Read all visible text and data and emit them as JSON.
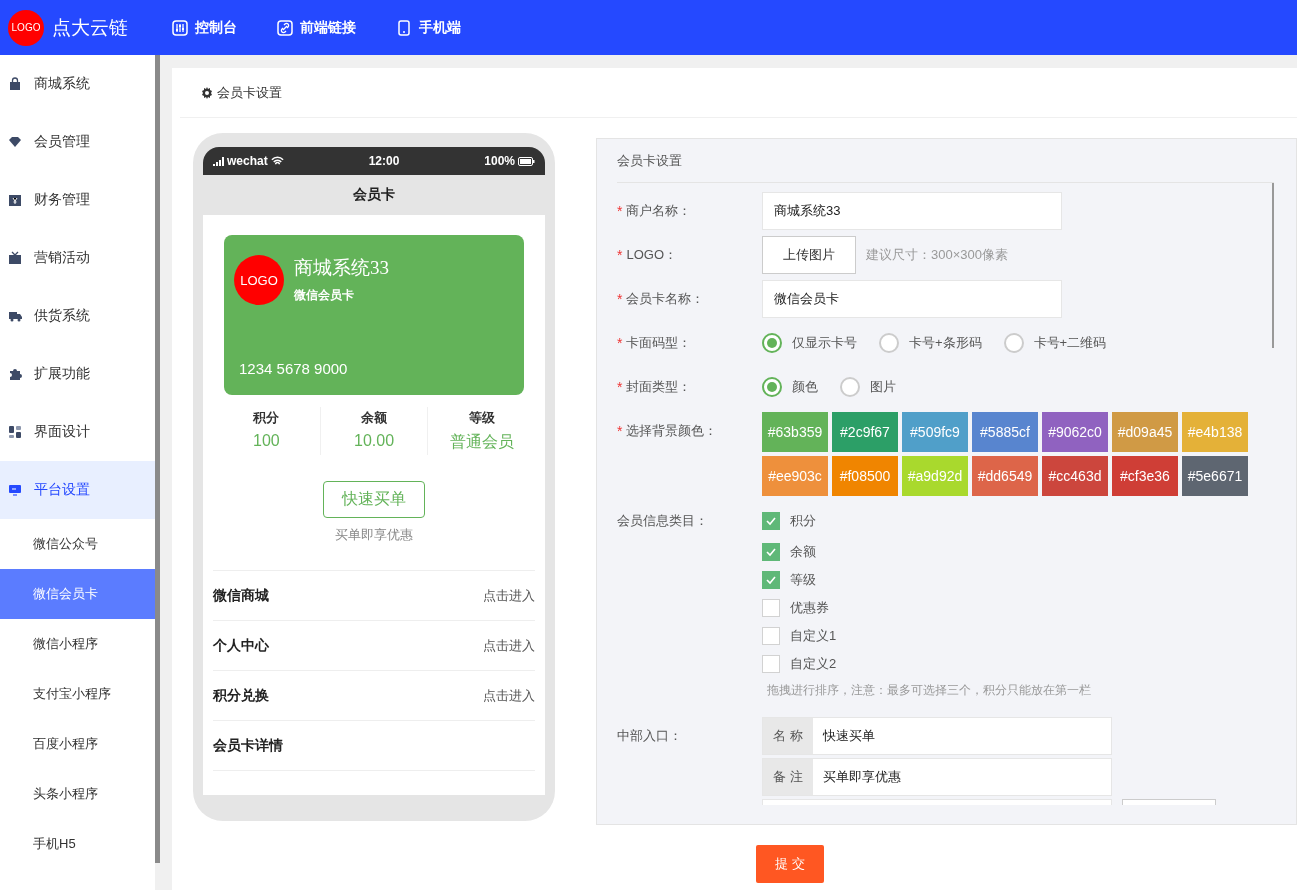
{
  "header": {
    "logo": "LOGO",
    "brand": "点大云链",
    "nav": [
      {
        "label": "控制台"
      },
      {
        "label": "前端链接"
      },
      {
        "label": "手机端"
      }
    ]
  },
  "sidebar": {
    "items": [
      {
        "label": "商城系统",
        "expanded": false
      },
      {
        "label": "会员管理",
        "expanded": false
      },
      {
        "label": "财务管理",
        "expanded": false
      },
      {
        "label": "营销活动",
        "expanded": false
      },
      {
        "label": "供货系统",
        "expanded": false
      },
      {
        "label": "扩展功能",
        "expanded": false
      },
      {
        "label": "界面设计",
        "expanded": false
      },
      {
        "label": "平台设置",
        "expanded": true,
        "children": [
          {
            "label": "微信公众号",
            "selected": false
          },
          {
            "label": "微信会员卡",
            "selected": true
          },
          {
            "label": "微信小程序",
            "selected": false
          },
          {
            "label": "支付宝小程序",
            "selected": false
          },
          {
            "label": "百度小程序",
            "selected": false
          },
          {
            "label": "头条小程序",
            "selected": false
          },
          {
            "label": "手机H5",
            "selected": false
          }
        ]
      }
    ]
  },
  "breadcrumb": "会员卡设置",
  "phone": {
    "carrier": "wechat",
    "time": "12:00",
    "battery": "100%",
    "title": "会员卡",
    "card": {
      "color": "#63b359",
      "logo": "LOGO",
      "name": "商城系统33",
      "subtitle": "微信会员卡",
      "number": "1234 5678 9000"
    },
    "stats": [
      {
        "label": "积分",
        "value": "100"
      },
      {
        "label": "余额",
        "value": "10.00"
      },
      {
        "label": "等级",
        "value": "普通会员"
      }
    ],
    "button": "快速买单",
    "note": "买单即享优惠",
    "links": [
      {
        "label": "微信商城",
        "action": "点击进入"
      },
      {
        "label": "个人中心",
        "action": "点击进入"
      },
      {
        "label": "积分兑换",
        "action": "点击进入"
      },
      {
        "label": "会员卡详情"
      }
    ]
  },
  "form": {
    "title": "会员卡设置",
    "fields": [
      {
        "kind": "text",
        "mark": "*",
        "label": "商户名称：",
        "value": "商城系统33"
      },
      {
        "kind": "upload",
        "mark": "*",
        "label": "LOGO：",
        "button": "上传图片",
        "hint": "建议尺寸：300×300像素"
      },
      {
        "kind": "text",
        "mark": "*",
        "label": "会员卡名称：",
        "value": "微信会员卡"
      },
      {
        "kind": "radio",
        "mark": "*",
        "label": "卡面码型：",
        "options": [
          {
            "label": "仅显示卡号",
            "selected": true
          },
          {
            "label": "卡号+条形码",
            "selected": false
          },
          {
            "label": "卡号+二维码",
            "selected": false
          }
        ]
      },
      {
        "kind": "radio",
        "mark": "*",
        "label": "封面类型：",
        "options": [
          {
            "label": "颜色",
            "selected": true
          },
          {
            "label": "图片",
            "selected": false
          }
        ]
      },
      {
        "kind": "swatches",
        "mark": "*",
        "label": "选择背景颜色：",
        "swatches": [
          {
            "label": "#63b359",
            "color": "#63b359"
          },
          {
            "label": "#2c9f67",
            "color": "#2c9f67"
          },
          {
            "label": "#509fc9",
            "color": "#509fc9"
          },
          {
            "label": "#5885cf",
            "color": "#5885cf"
          },
          {
            "label": "#9062c0",
            "color": "#9062c0"
          },
          {
            "label": "#d09a45",
            "color": "#d09a45"
          },
          {
            "label": "#e4b138",
            "color": "#e4b138"
          },
          {
            "label": "#ee903c",
            "color": "#ee903c"
          },
          {
            "label": "#f08500",
            "color": "#f08500"
          },
          {
            "label": "#a9d92d",
            "color": "#a9d92d"
          },
          {
            "label": "#dd6549",
            "color": "#dd6549"
          },
          {
            "label": "#cc463d",
            "color": "#cc463d"
          },
          {
            "label": "#cf3e36",
            "color": "#cf3e36"
          },
          {
            "label": "#5e6671",
            "color": "#5e6671"
          }
        ]
      },
      {
        "kind": "checkboxes",
        "label": "会员信息类目：",
        "options": [
          {
            "label": "积分",
            "checked": true
          },
          {
            "label": "余额",
            "checked": true
          },
          {
            "label": "等级",
            "checked": true
          },
          {
            "label": "优惠券",
            "checked": false
          },
          {
            "label": "自定义1",
            "checked": false
          },
          {
            "label": "自定义2",
            "checked": false
          }
        ],
        "hint": "拖拽进行排序，注意：最多可选择三个，积分只能放在第一栏"
      },
      {
        "kind": "entry",
        "label": "中部入口：",
        "rows": [
          {
            "label": "名 称",
            "value": "快速买单"
          },
          {
            "label": "备 注",
            "value": "买单即享优惠"
          }
        ]
      }
    ]
  },
  "submit": "提 交"
}
